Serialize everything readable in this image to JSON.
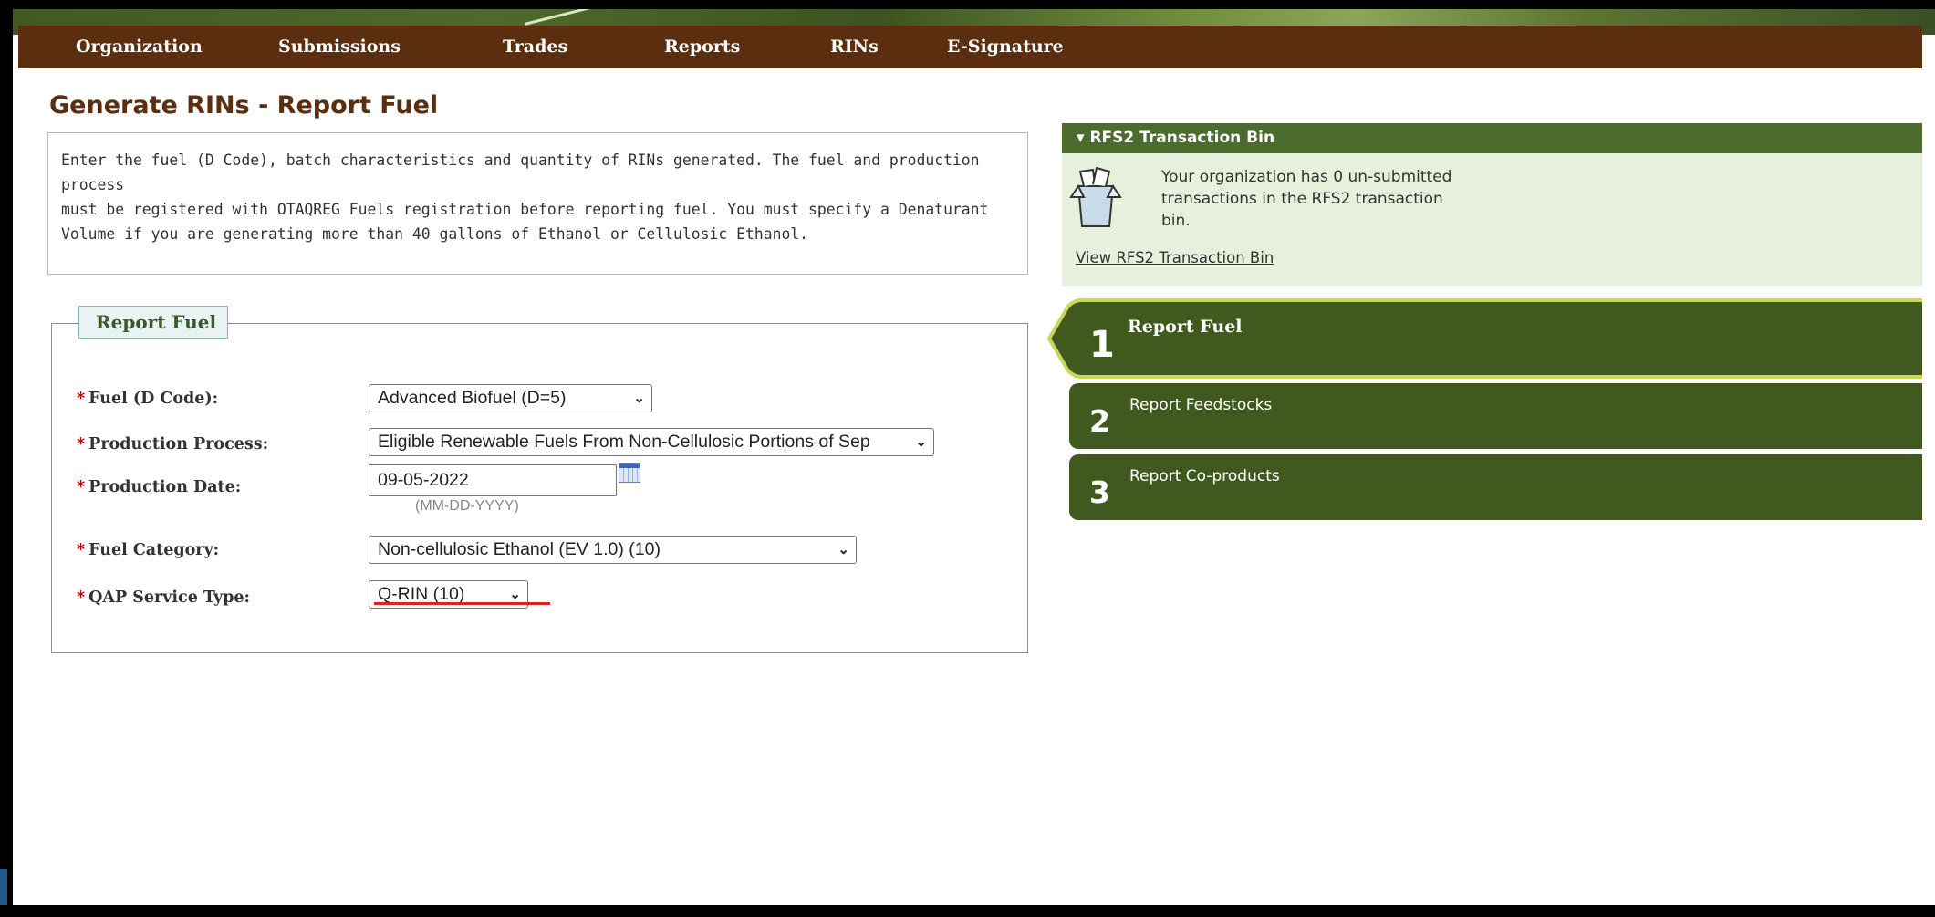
{
  "nav": {
    "items": [
      "Organization",
      "Submissions",
      "Trades",
      "Reports",
      "RINs",
      "E-Signature"
    ]
  },
  "page": {
    "title": "Generate RINs - Report Fuel",
    "intro_lines": [
      "Enter the fuel (D Code), batch characteristics and quantity of RINs generated. The fuel and production process",
      "must be registered with OTAQREG Fuels registration before reporting fuel. You must specify a Denaturant",
      "Volume if you are generating more than 40 gallons of Ethanol or Cellulosic Ethanol."
    ]
  },
  "form": {
    "legend": "Report Fuel",
    "required_mark": "*",
    "fuel_label": "Fuel (D Code):",
    "fuel_value": "Advanced Biofuel (D=5)",
    "process_label": "Production Process:",
    "process_value": "Eligible Renewable Fuels From Non-Cellulosic Portions of Sep",
    "date_label": "Production Date:",
    "date_value": "09-05-2022",
    "date_hint": "(MM-DD-YYYY)",
    "category_label": "Fuel Category:",
    "category_value": "Non-cellulosic Ethanol (EV 1.0) (10)",
    "qap_label": "QAP Service Type:",
    "qap_value": "Q-RIN (10)",
    "dropdown_glyph": "⌄"
  },
  "sidebar": {
    "bin_title": "▾ RFS2 Transaction Bin",
    "bin_message": "Your organization has 0 un-submitted transactions in the RFS2 transaction bin.",
    "bin_link": "View RFS2 Transaction Bin",
    "steps": [
      {
        "num": "1",
        "label": "Report Fuel"
      },
      {
        "num": "2",
        "label": "Report Feedstocks"
      },
      {
        "num": "3",
        "label": "Report Co-products"
      }
    ]
  },
  "colors": {
    "nav_bg": "#5a2e0f",
    "title": "#5a2e0f",
    "step_bg": "#40591e",
    "active_border": "#c8d85a",
    "required": "#c00000",
    "highlight_underline": "#d9252a"
  },
  "icons": {
    "bin": "transaction-bin-icon",
    "calendar": "calendar-icon"
  }
}
